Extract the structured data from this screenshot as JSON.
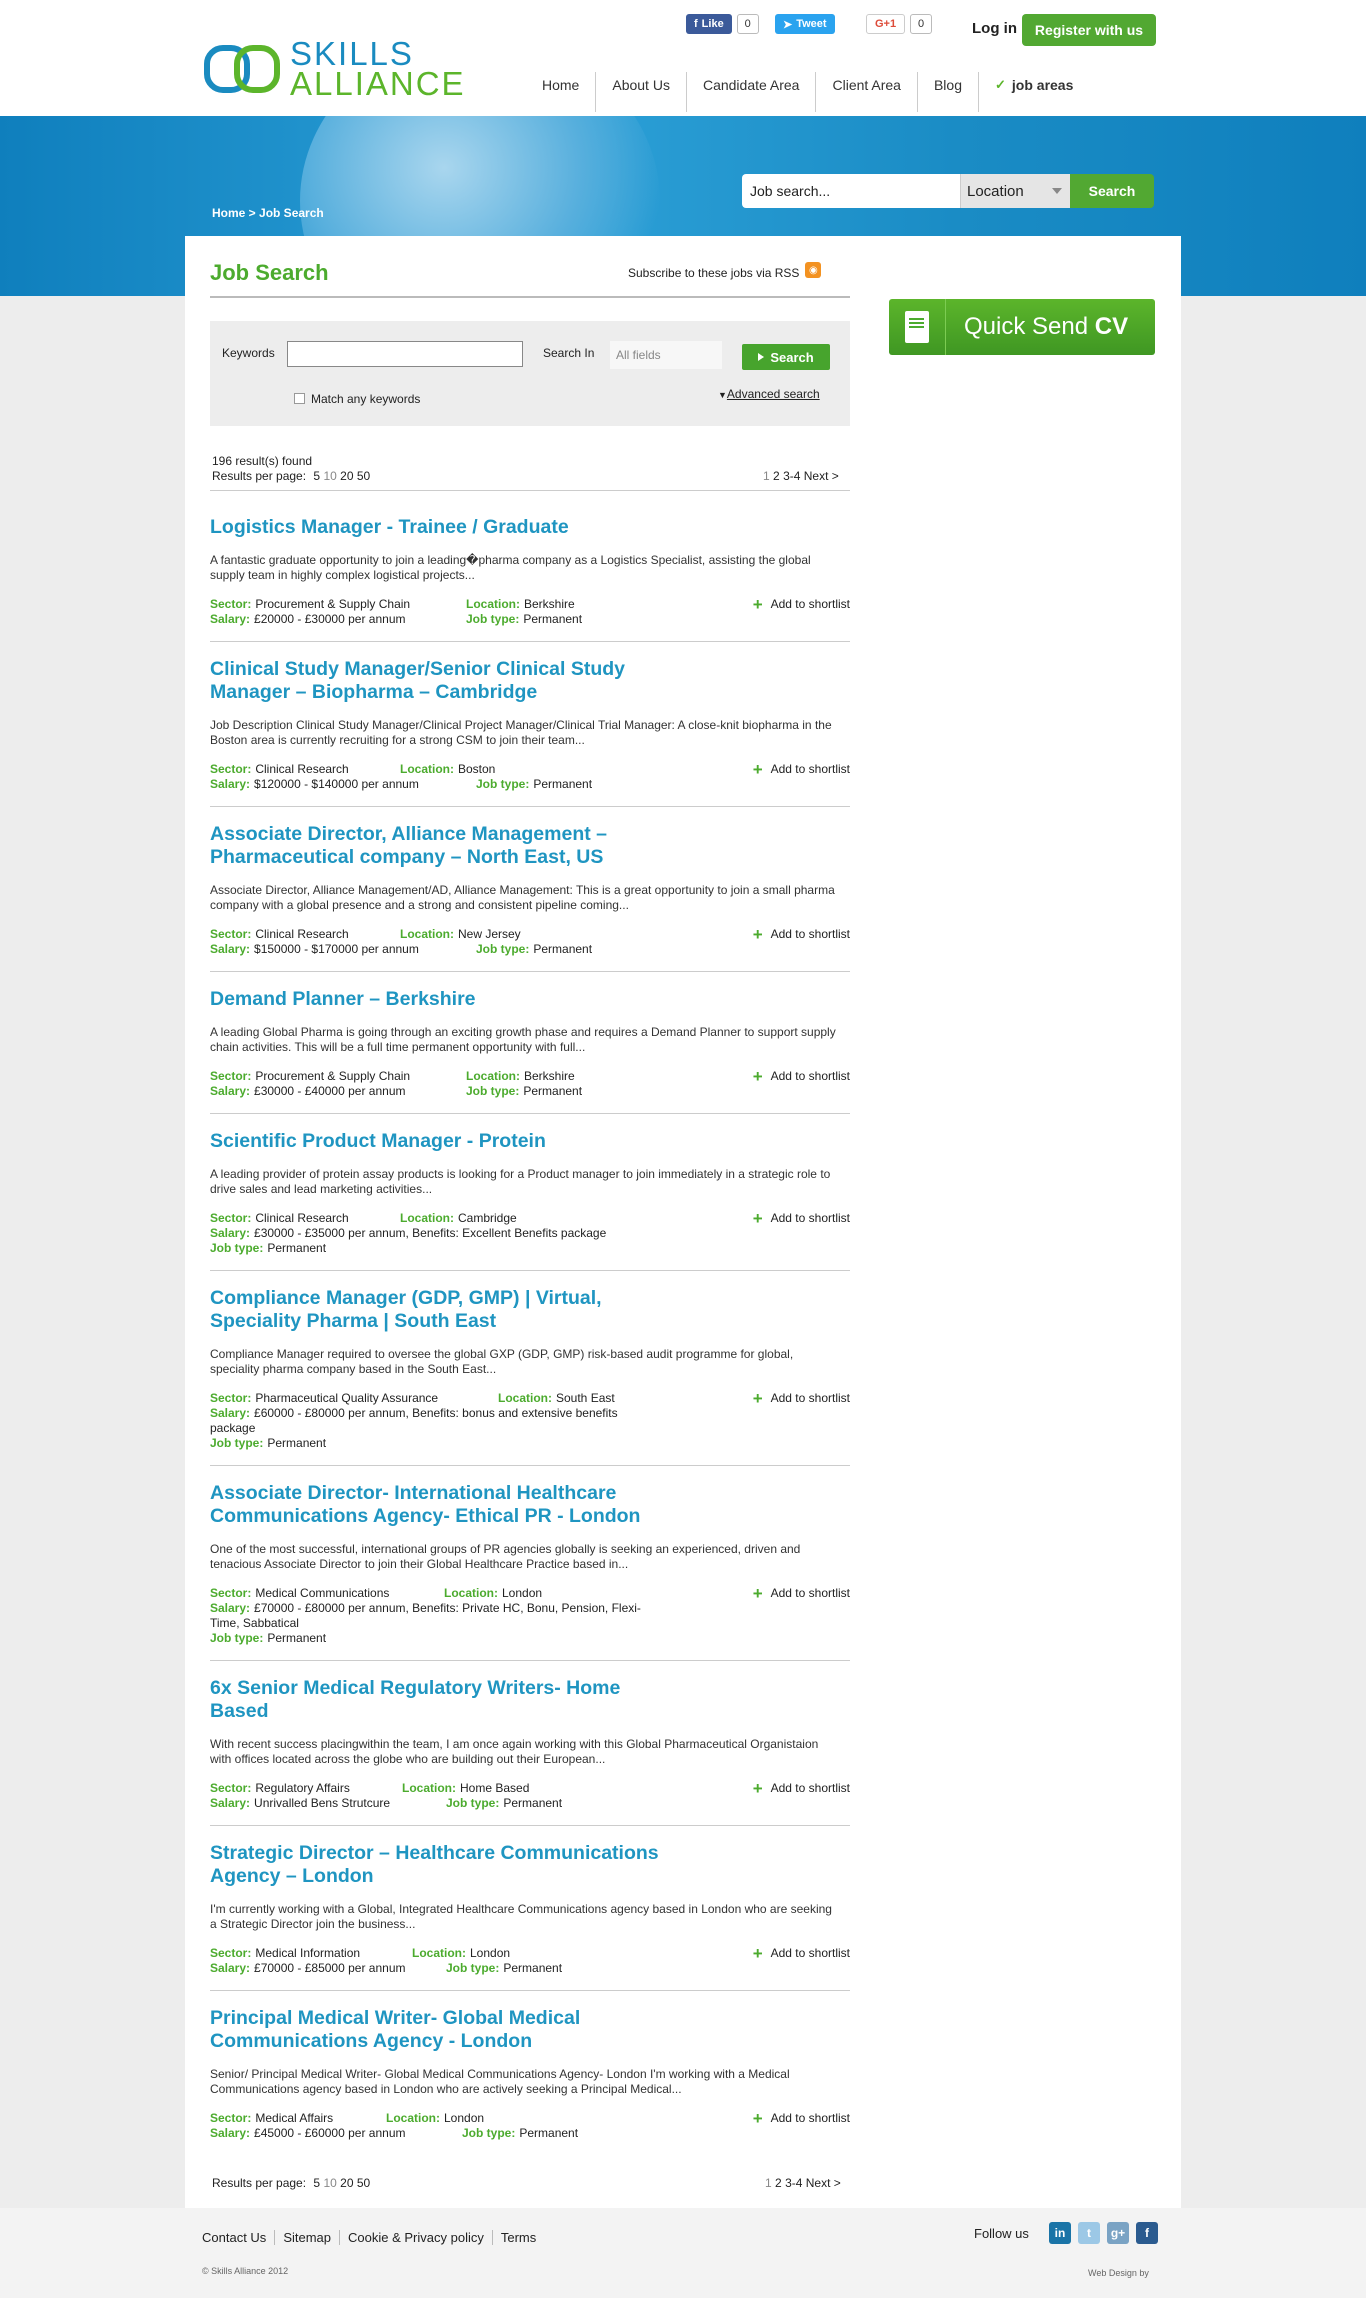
{
  "header": {
    "logo_line1": "SKILLS",
    "logo_line2": "ALLIANCE",
    "social": {
      "fb_label": "Like",
      "fb_count": "0",
      "tweet_label": "Tweet",
      "gplus_label": "G+1",
      "gplus_count": "0"
    },
    "login": "Log in",
    "register": "Register with us",
    "nav": [
      "Home",
      "About Us",
      "Candidate Area",
      "Client Area",
      "Blog",
      "job areas"
    ]
  },
  "banner": {
    "breadcrumb": "Home > Job Search",
    "search_placeholder": "Job search...",
    "location_selected": "Location",
    "search_button": "Search"
  },
  "main": {
    "title": "Job Search",
    "rss_text": "Subscribe to these jobs via RSS",
    "search_form": {
      "keywords_label": "Keywords",
      "keywords_value": "",
      "search_in_label": "Search In",
      "search_in_value": "All fields",
      "search_button": "Search",
      "match_any_label": "Match any keywords",
      "advanced_label": "Advanced search"
    },
    "results_found": "196 result(s) found",
    "results_per_page_label": "Results per page:",
    "per_page_options": [
      "5",
      "10",
      "20",
      "50"
    ],
    "per_page_current": "10",
    "pager": {
      "pages": [
        "1",
        "2",
        "3-4"
      ],
      "current": "1",
      "next": "Next >"
    },
    "shortlist_label": "Add to shortlist",
    "labels": {
      "sector": "Sector:",
      "location": "Location:",
      "salary": "Salary:",
      "job_type": "Job type:"
    },
    "jobs": [
      {
        "title": "Logistics Manager - Trainee / Graduate",
        "desc": "A fantastic graduate opportunity to join a leading�pharma company as a Logistics Specialist, assisting the global supply team in highly complex logistical projects...",
        "sector": "Procurement & Supply Chain",
        "location": "Berkshire",
        "salary": "£20000 - £30000 per annum",
        "job_type": "Permanent"
      },
      {
        "title": "Clinical Study Manager/Senior Clinical Study Manager – Biopharma – Cambridge",
        "desc": "Job Description Clinical Study Manager/Clinical Project Manager/Clinical Trial Manager: A close-knit biopharma in the Boston area is currently recruiting for a strong CSM to join their team...",
        "sector": "Clinical Research",
        "location": "Boston",
        "salary": "$120000 - $140000 per annum",
        "job_type": "Permanent"
      },
      {
        "title": "Associate Director, Alliance Management – Pharmaceutical company – North East, US",
        "desc": "Associate Director, Alliance Management/AD, Alliance Management: This is a great opportunity to join a small pharma company with a global presence and a strong and consistent pipeline coming...",
        "sector": "Clinical Research",
        "location": "New Jersey",
        "salary": "$150000 - $170000 per annum",
        "job_type": "Permanent"
      },
      {
        "title": "Demand Planner – Berkshire",
        "desc": "A leading Global Pharma is going through an exciting growth phase and requires a Demand Planner to support supply chain activities. This will be a full time permanent opportunity with full...",
        "sector": "Procurement & Supply Chain",
        "location": "Berkshire",
        "salary": "£30000 - £40000 per annum",
        "job_type": "Permanent"
      },
      {
        "title": "Scientific Product Manager - Protein",
        "desc": "A leading provider of protein assay products is looking for a Product manager to join immediately in a strategic role to drive sales and lead marketing activities...",
        "sector": "Clinical Research",
        "location": "Cambridge",
        "salary": "£30000 - £35000 per annum, Benefits: Excellent Benefits package",
        "job_type": "Permanent"
      },
      {
        "title": "Compliance Manager (GDP, GMP) | Virtual, Speciality Pharma | South East",
        "desc": "Compliance Manager required to oversee the global GXP (GDP, GMP) risk-based audit programme for global, speciality pharma company based in the South East...",
        "sector": "Pharmaceutical Quality Assurance",
        "location": "South East",
        "salary": "£60000 - £80000 per annum, Benefits: bonus and extensive benefits package",
        "job_type": "Permanent"
      },
      {
        "title": "Associate Director- International Healthcare Communications Agency- Ethical PR - London",
        "desc": "One of the most successful, international groups of PR agencies globally is seeking an experienced, driven and tenacious Associate Director to join their Global Healthcare Practice based in...",
        "sector": "Medical Communications",
        "location": "London",
        "salary": "£70000 - £80000 per annum, Benefits: Private HC, Bonu, Pension, Flexi- Time, Sabbatical",
        "job_type": "Permanent"
      },
      {
        "title": "6x Senior Medical Regulatory Writers- Home Based",
        "desc": "With recent success placingwithin the team, I am once again working with this Global Pharmaceutical Organistaion with offices located across the globe who are building out their European...",
        "sector": "Regulatory Affairs",
        "location": "Home Based",
        "salary": "Unrivalled Bens Strutcure",
        "job_type": "Permanent"
      },
      {
        "title": "Strategic Director – Healthcare Communications Agency – London",
        "desc": "I'm currently working with a Global, Integrated Healthcare Communications agency based in London who are seeking a Strategic Director join the business...",
        "sector": "Medical Information",
        "location": "London",
        "salary": "£70000 - £85000 per annum",
        "job_type": "Permanent"
      },
      {
        "title": "Principal Medical Writer- Global Medical Communications Agency - London",
        "desc": "Senior/ Principal Medical Writer- Global Medical Communications Agency- London I'm working with a Medical Communications agency based in London who are actively seeking a Principal Medical...",
        "sector": "Medical Affairs",
        "location": "London",
        "salary": "£45000 - £60000 per annum",
        "job_type": "Permanent"
      }
    ]
  },
  "sidebar": {
    "quick_send_label": "Quick Send",
    "quick_send_bold": "CV"
  },
  "footer": {
    "links": [
      "Contact Us",
      "Sitemap",
      "Cookie & Privacy policy",
      "Terms"
    ],
    "follow_us": "Follow us",
    "social_icons": [
      "linkedin-icon",
      "twitter-icon",
      "googleplus-icon",
      "facebook-icon"
    ],
    "copyright": "© Skills Alliance 2012",
    "web_design": "Web Design by"
  },
  "colors": {
    "brand_blue": "#1f95c1",
    "brand_green": "#4cab2e",
    "banner_blue": "#0f7fbd"
  }
}
